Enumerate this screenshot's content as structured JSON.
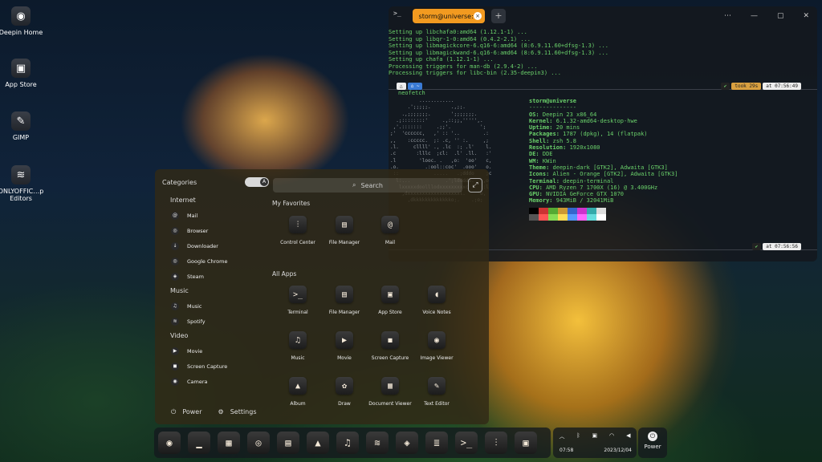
{
  "desktop": [
    {
      "label": "Deepin Home",
      "icon": "deepin-home-icon",
      "glyph": "◉"
    },
    {
      "label": "App Store",
      "icon": "app-store-icon",
      "glyph": "▣"
    },
    {
      "label": "GIMP",
      "icon": "gimp-icon",
      "glyph": "✎"
    },
    {
      "label": "ONLYOFFIC…p Editors",
      "icon": "onlyoffice-icon",
      "glyph": "≋"
    }
  ],
  "terminal": {
    "tab_title": "storm@universe:~",
    "output_lines": [
      "Setting up libchafa0:amd64 (1.12.1-1) ...",
      "Setting up libqr-1-0:amd64 (0.4.2-2.1) ...",
      "Setting up libmagickcore-6.q16-6:amd64 (8:6.9.11.60+dfsg-1.3) ...",
      "Setting up libmagickwand-6.q16-6:amd64 (8:6.9.11.60+dfsg-1.3) ...",
      "Setting up chafa (1.12.1-1) ...",
      "Processing triggers for man-db (2.9.4-2) ...",
      "Processing triggers for libc-bin (2.35-deepin3) ..."
    ],
    "prompt1": {
      "took": "took 29s",
      "at": "at 07:56:49"
    },
    "command": "neofetch",
    "neofetch_user": "storm@universe",
    "neofetch_sep": "--------------",
    "neofetch_info": [
      {
        "k": "OS:",
        "v": "Deepin 23 x86_64"
      },
      {
        "k": "Kernel:",
        "v": "6.1.32-amd64-desktop-hwe"
      },
      {
        "k": "Uptime:",
        "v": "20 mins"
      },
      {
        "k": "Packages:",
        "v": "1787 (dpkg), 14 (flatpak)"
      },
      {
        "k": "Shell:",
        "v": "zsh 5.8"
      },
      {
        "k": "Resolution:",
        "v": "1920x1080"
      },
      {
        "k": "DE:",
        "v": "DDE"
      },
      {
        "k": "WM:",
        "v": "KWin"
      },
      {
        "k": "Theme:",
        "v": "deepin-dark [GTK2], Adwaita [GTK3]"
      },
      {
        "k": "Icons:",
        "v": "Alien - Orange [GTK2], Adwaita [GTK3]"
      },
      {
        "k": "Terminal:",
        "v": "deepin-terminal"
      },
      {
        "k": "CPU:",
        "v": "AMD Ryzen 7 1700X (16) @ 3.400GHz"
      },
      {
        "k": "GPU:",
        "v": "NVIDIA GeForce GTX 1070"
      },
      {
        "k": "Memory:",
        "v": "943MiB / 32041MiB"
      }
    ],
    "prompt2": {
      "at": "at 07:56:56"
    },
    "palette_top": [
      "#000000",
      "#cc3333",
      "#55aa33",
      "#cc9933",
      "#3366cc",
      "#cc33cc",
      "#33aaaa",
      "#dddddd"
    ],
    "palette_bottom": [
      "#555555",
      "#ff5555",
      "#88dd55",
      "#ffdd55",
      "#5599ff",
      "#ff66ff",
      "#66dddd",
      "#ffffff"
    ]
  },
  "launcher": {
    "categories_title": "Categories",
    "search_placeholder": "Search",
    "favorites_title": "My Favorites",
    "all_apps_title": "All Apps",
    "categories": [
      {
        "name": "Internet",
        "items": [
          "Mail",
          "Browser",
          "Downloader",
          "Google Chrome",
          "Steam"
        ]
      },
      {
        "name": "Music",
        "items": [
          "Music",
          "Spotify"
        ]
      },
      {
        "name": "Video",
        "items": [
          "Movie",
          "Screen Capture",
          "Camera"
        ]
      }
    ],
    "favorites": [
      {
        "label": "Control Center",
        "glyph": "⫶"
      },
      {
        "label": "File Manager",
        "glyph": "▤"
      },
      {
        "label": "Mail",
        "glyph": "@"
      }
    ],
    "apps": [
      {
        "label": "Terminal",
        "glyph": ">_"
      },
      {
        "label": "File Manager",
        "glyph": "▤"
      },
      {
        "label": "App Store",
        "glyph": "▣"
      },
      {
        "label": "Voice Notes",
        "glyph": "◖"
      },
      {
        "label": "Music",
        "glyph": "♫"
      },
      {
        "label": "Movie",
        "glyph": "▶"
      },
      {
        "label": "Screen Capture",
        "glyph": "◼"
      },
      {
        "label": "Image Viewer",
        "glyph": "◉"
      },
      {
        "label": "Album",
        "glyph": "▲"
      },
      {
        "label": "Draw",
        "glyph": "✿"
      },
      {
        "label": "Document Viewer",
        "glyph": "▦"
      },
      {
        "label": "Text Editor",
        "glyph": "✎"
      }
    ],
    "power_label": "Power",
    "settings_label": "Settings"
  },
  "dock": {
    "icons": [
      {
        "name": "launcher",
        "glyph": "◉"
      },
      {
        "name": "multitask",
        "glyph": "▁"
      },
      {
        "name": "workspace",
        "glyph": "▦"
      },
      {
        "name": "chrome",
        "glyph": "◎"
      },
      {
        "name": "file-manager",
        "glyph": "▤"
      },
      {
        "name": "album",
        "glyph": "▲"
      },
      {
        "name": "music",
        "glyph": "♫"
      },
      {
        "name": "spotify",
        "glyph": "≋"
      },
      {
        "name": "steam",
        "glyph": "◈"
      },
      {
        "name": "layers",
        "glyph": "≣"
      },
      {
        "name": "terminal",
        "glyph": ">_"
      },
      {
        "name": "control-center",
        "glyph": "⫶"
      },
      {
        "name": "app-store",
        "glyph": "▣"
      }
    ],
    "time": "07:58",
    "date": "2023/12/04",
    "power_label": "Power"
  }
}
